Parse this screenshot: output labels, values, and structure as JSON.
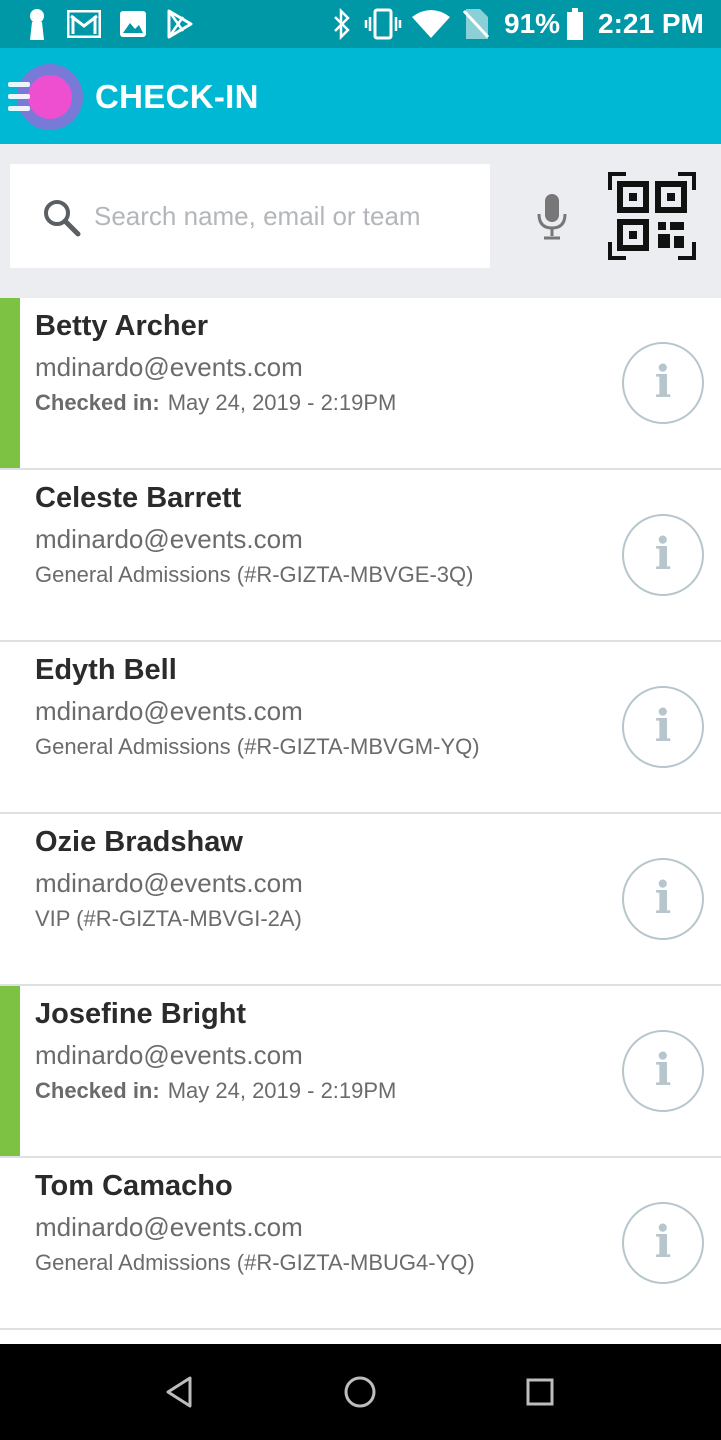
{
  "status_bar": {
    "battery_percent": "91%",
    "time": "2:21 PM",
    "left_icons": [
      "keyhole-icon",
      "gmail-icon",
      "image-icon",
      "play-store-icon"
    ],
    "right_icons": [
      "bluetooth-icon",
      "vibrate-icon",
      "wifi-icon",
      "no-sim-icon",
      "battery-icon"
    ]
  },
  "app_bar": {
    "title": "CHECK-IN",
    "menu_icon": "menu-logo-icon"
  },
  "search": {
    "placeholder": "Search name, email or team",
    "value": "",
    "mic_icon": "microphone-icon",
    "qr_icon": "qr-code-icon"
  },
  "attendees": [
    {
      "name": "Betty Archer",
      "email": "mdinardo@events.com",
      "checked_in": true,
      "checked_in_label": "Checked in:",
      "checked_in_time": "May 24, 2019 - 2:19PM",
      "ticket": ""
    },
    {
      "name": "Celeste Barrett",
      "email": "mdinardo@events.com",
      "checked_in": false,
      "checked_in_label": "",
      "checked_in_time": "",
      "ticket": "General Admissions (#R-GIZTA-MBVGE-3Q)"
    },
    {
      "name": "Edyth Bell",
      "email": "mdinardo@events.com",
      "checked_in": false,
      "checked_in_label": "",
      "checked_in_time": "",
      "ticket": "General Admissions (#R-GIZTA-MBVGM-YQ)"
    },
    {
      "name": "Ozie Bradshaw",
      "email": "mdinardo@events.com",
      "checked_in": false,
      "checked_in_label": "",
      "checked_in_time": "",
      "ticket": "VIP (#R-GIZTA-MBVGI-2A)"
    },
    {
      "name": "Josefine Bright",
      "email": "mdinardo@events.com",
      "checked_in": true,
      "checked_in_label": "Checked in:",
      "checked_in_time": "May 24, 2019 - 2:19PM",
      "ticket": ""
    },
    {
      "name": "Tom Camacho",
      "email": "mdinardo@events.com",
      "checked_in": false,
      "checked_in_label": "",
      "checked_in_time": "",
      "ticket": "General Admissions (#R-GIZTA-MBUG4-YQ)"
    }
  ],
  "info_icon_glyph": "i",
  "colors": {
    "status_bar": "#0097a7",
    "app_bar": "#00b8d4",
    "checked_in_accent": "#7dc242",
    "info_icon": "#b7c6cd"
  },
  "nav_bar": {
    "buttons": [
      "back-icon",
      "home-icon",
      "recents-icon"
    ]
  }
}
